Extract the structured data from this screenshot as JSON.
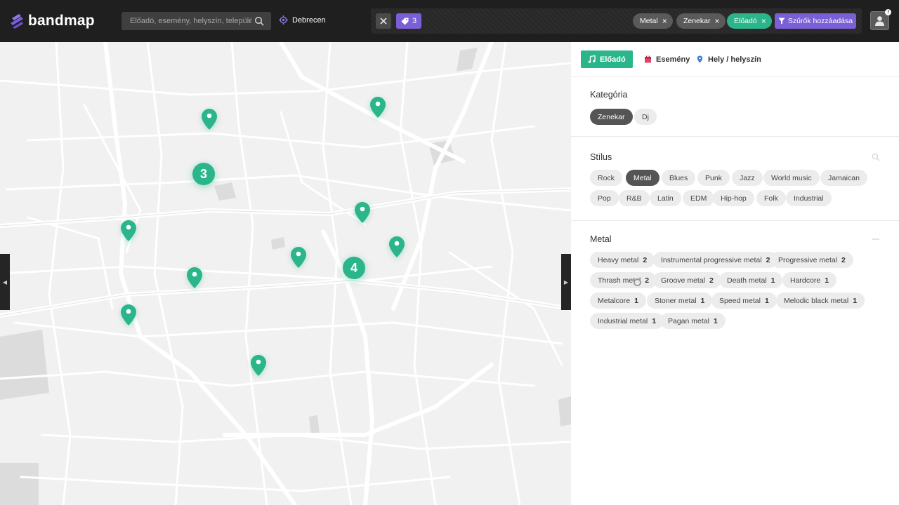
{
  "app": {
    "name": "bandmap"
  },
  "search": {
    "placeholder": "Előadó, esemény, helyszín, település..."
  },
  "location": {
    "label": "Debrecen"
  },
  "filters": {
    "tag_count": "3",
    "chips": [
      {
        "label": "Metal",
        "style": "gray"
      },
      {
        "label": "Zenekar",
        "style": "gray"
      },
      {
        "label": "Előadó",
        "style": "green"
      }
    ],
    "add_label": "Szűrők hozzáadása"
  },
  "user": {
    "badge": "!"
  },
  "map": {
    "clusters": [
      {
        "count": "3"
      },
      {
        "count": "4"
      }
    ],
    "pin_color": "#2bb58a"
  },
  "tabs": [
    {
      "label": "Előadó",
      "active": true,
      "icon": "music-note-icon"
    },
    {
      "label": "Esemény",
      "active": false,
      "icon": "calendar-icon"
    },
    {
      "label": "Hely / helyszín",
      "active": false,
      "icon": "map-pin-icon"
    }
  ],
  "category": {
    "title": "Kategória",
    "options": [
      {
        "label": "Zenekar",
        "selected": true
      },
      {
        "label": "Dj",
        "selected": false
      }
    ]
  },
  "style": {
    "title": "Stílus",
    "options": [
      {
        "label": "Rock",
        "selected": false
      },
      {
        "label": "Metal",
        "selected": true
      },
      {
        "label": "Blues",
        "selected": false
      },
      {
        "label": "Punk",
        "selected": false
      },
      {
        "label": "Jazz",
        "selected": false
      },
      {
        "label": "World music",
        "selected": false
      },
      {
        "label": "Jamaican",
        "selected": false
      },
      {
        "label": "Pop",
        "selected": false
      },
      {
        "label": "R&B",
        "selected": false
      },
      {
        "label": "Latin",
        "selected": false
      },
      {
        "label": "EDM",
        "selected": false
      },
      {
        "label": "Hip-hop",
        "selected": false
      },
      {
        "label": "Folk",
        "selected": false
      },
      {
        "label": "Industrial",
        "selected": false
      }
    ]
  },
  "metal": {
    "title": "Metal",
    "subgenres": [
      {
        "label": "Heavy metal",
        "count": "2"
      },
      {
        "label": "Instrumental progressive metal",
        "count": "2"
      },
      {
        "label": "Progressive metal",
        "count": "2"
      },
      {
        "label": "Thrash metal",
        "count": "2"
      },
      {
        "label": "Groove metal",
        "count": "2"
      },
      {
        "label": "Death metal",
        "count": "1"
      },
      {
        "label": "Hardcore",
        "count": "1"
      },
      {
        "label": "Metalcore",
        "count": "1"
      },
      {
        "label": "Stoner metal",
        "count": "1"
      },
      {
        "label": "Speed metal",
        "count": "1"
      },
      {
        "label": "Melodic black metal",
        "count": "1"
      },
      {
        "label": "Industrial metal",
        "count": "1"
      },
      {
        "label": "Pagan metal",
        "count": "1"
      }
    ]
  },
  "colors": {
    "accent_green": "#2bb58a",
    "accent_purple": "#7b5fd6",
    "topbar": "#1f1f1f"
  }
}
